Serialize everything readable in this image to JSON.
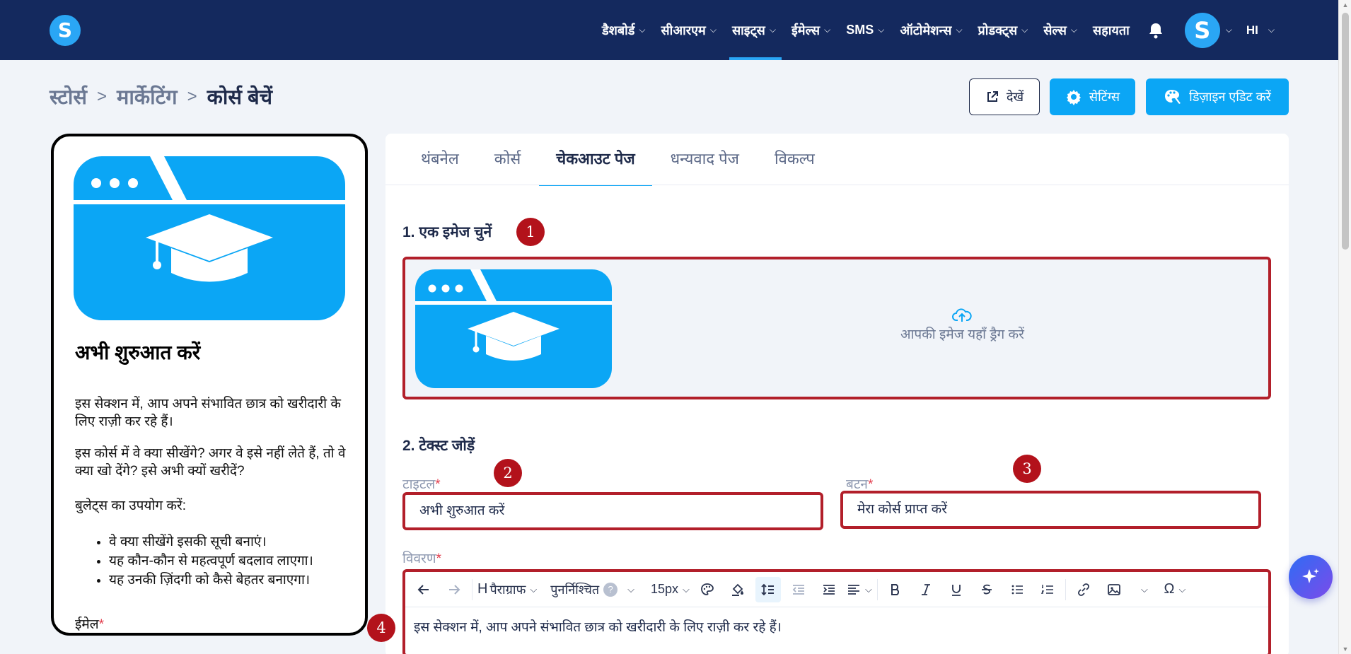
{
  "nav": {
    "logo_letter": "S",
    "items": [
      {
        "label": "डैशबोर्ड",
        "dropdown": true
      },
      {
        "label": "सीआरएम",
        "dropdown": true
      },
      {
        "label": "साइट्स",
        "dropdown": true,
        "active": true
      },
      {
        "label": "ईमेल्स",
        "dropdown": true
      },
      {
        "label": "SMS",
        "dropdown": true
      },
      {
        "label": "ऑटोमेशन्स",
        "dropdown": true
      },
      {
        "label": "प्रोडक्ट्स",
        "dropdown": true
      },
      {
        "label": "सेल्स",
        "dropdown": true
      },
      {
        "label": "सहायता",
        "dropdown": false
      }
    ],
    "avatar_letter": "S",
    "language": "HI",
    "accent_color": "#2aa6f5",
    "background_color": "#14295e"
  },
  "breadcrumb": {
    "items": [
      "स्टोर्स",
      "मार्केटिंग",
      "कोर्स बेचें"
    ],
    "separator": ">"
  },
  "header_buttons": {
    "view": "देखें",
    "settings": "सेटिंग्स",
    "design": "डिज़ाइन एडिट करें"
  },
  "preview": {
    "title": "अभी शुरुआत करें",
    "paragraph1": "इस सेक्शन में, आप अपने संभावित छात्र को खरीदारी के लिए राज़ी कर रहे हैं।",
    "paragraph2": "इस कोर्स में वे क्या सीखेंगे? अगर वे इसे नहीं लेते हैं, तो वे क्या खो देंगे? इसे अभी क्यों खरीदें?",
    "paragraph3": "बुलेट्स का उपयोग करें:",
    "bullets": [
      "वे क्या सीखेंगे इसकी सूची बनाएं।",
      "यह कौन-कौन से महत्वपूर्ण बदलाव लाएगा।",
      "यह उनकी ज़िंदगी को कैसे बेहतर बनाएगा।"
    ],
    "email_label": "ईमेल",
    "required_mark": "*"
  },
  "tabs": [
    {
      "label": "थंबनेल"
    },
    {
      "label": "कोर्स"
    },
    {
      "label": "चेकआउट पेज",
      "active": true
    },
    {
      "label": "धन्यवाद पेज"
    },
    {
      "label": "विकल्प"
    }
  ],
  "section1": {
    "heading": "1. एक इमेज चुनें",
    "badge": "1",
    "dropzone_text": "आपकी इमेज यहाँ ड्रैग करें"
  },
  "section2": {
    "heading": "2. टेक्स्ट जोड़ें",
    "title_label": "टाइटल",
    "title_value": "अभी शुरुआत करें",
    "title_badge": "2",
    "button_label": "बटन",
    "button_value": "मेरा कोर्स प्राप्त करें",
    "button_badge": "3",
    "description_label": "विवरण",
    "description_badge": "4",
    "description_value": "इस सेक्शन में, आप अपने संभावित छात्र को खरीदारी के लिए राज़ी कर रहे हैं।",
    "required_mark": "*"
  },
  "toolbar": {
    "heading_prefix": "H",
    "paragraph": "पैराग्राफ",
    "reusable": "पुनर्निश्चित",
    "help_mark": "?",
    "font_size": "15px",
    "special_char": "Ω"
  },
  "colors": {
    "primary_button": "#0ba6f5",
    "highlight_border": "#b21f2a",
    "badge": "#b3121b"
  }
}
